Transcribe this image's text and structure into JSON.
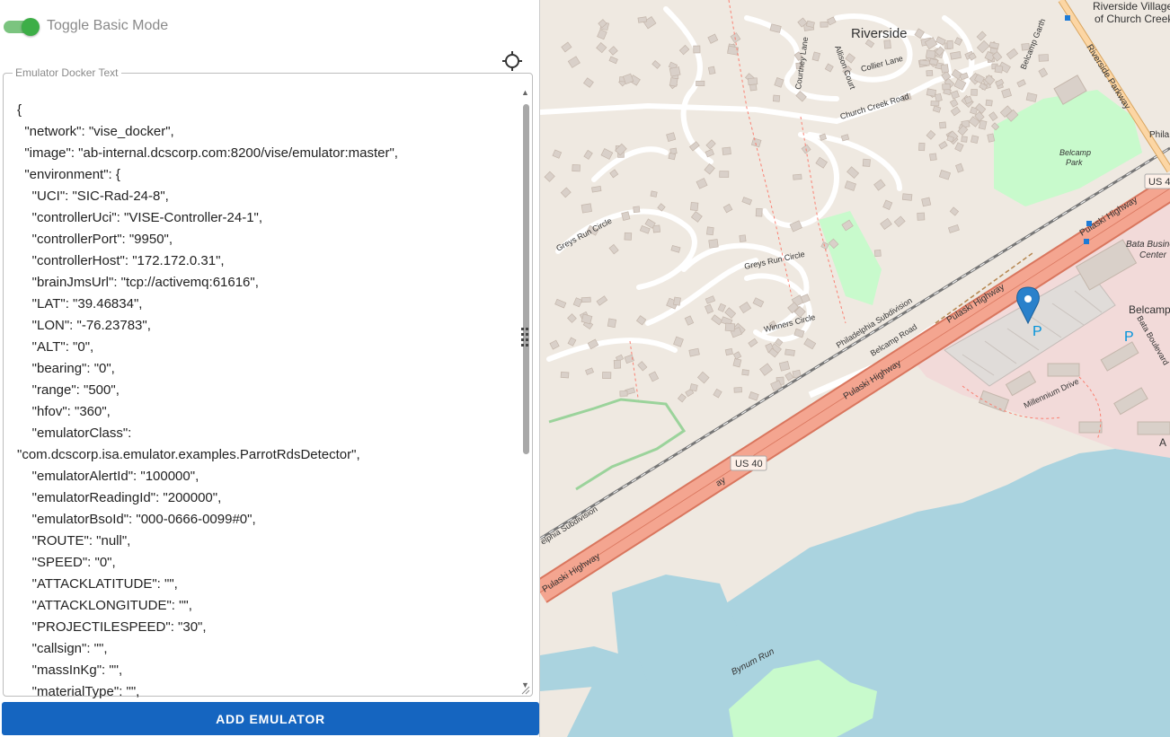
{
  "toggle": {
    "label": "Toggle Basic Mode",
    "on": true
  },
  "emulator_box": {
    "legend": "Emulator Docker Text",
    "lines": [
      "{",
      "  \"network\": \"vise_docker\",",
      "  \"image\": \"ab-internal.dcscorp.com:8200/vise/emulator:master\",",
      "  \"environment\": {",
      "    \"UCI\": \"SIC-Rad-24-8\",",
      "    \"controllerUci\": \"VISE-Controller-24-1\",",
      "    \"controllerPort\": \"9950\",",
      "    \"controllerHost\": \"172.172.0.31\",",
      "    \"brainJmsUrl\": \"tcp://activemq:61616\",",
      "    \"LAT\": \"39.46834\",",
      "    \"LON\": \"-76.23783\",",
      "    \"ALT\": \"0\",",
      "    \"bearing\": \"0\",",
      "    \"range\": \"500\",",
      "    \"hfov\": \"360\",",
      "    \"emulatorClass\":",
      "\"com.dcscorp.isa.emulator.examples.ParrotRdsDetector\",",
      "    \"emulatorAlertId\": \"100000\",",
      "    \"emulatorReadingId\": \"200000\",",
      "    \"emulatorBsoId\": \"000-0666-0099#0\",",
      "    \"ROUTE\": \"null\",",
      "    \"SPEED\": \"0\",",
      "    \"ATTACKLATITUDE\": \"\",",
      "    \"ATTACKLONGITUDE\": \"\",",
      "    \"PROJECTILESPEED\": \"30\",",
      "    \"callsign\": \"\",",
      "    \"massInKg\": \"\",",
      "    \"materialType\": \"\","
    ]
  },
  "add_button": {
    "label": "ADD EMULATOR"
  },
  "map": {
    "labels": {
      "riverside": "Riverside",
      "riverside_village_1": "Riverside Village",
      "riverside_village_2": "of Church Creek",
      "riverside_parkway": "Riverside Parkway",
      "belcamp_garth": "Belcamp Garth",
      "courtney_lane": "Courtney Lane",
      "allison_court": "Allison Court",
      "collier_lane": "Collier Lane",
      "church_creek_road": "Church Creek Road",
      "belcamp_park_1": "Belcamp",
      "belcamp_park_2": "Park",
      "greys_run_circle_1": "Greys Run Circle",
      "greys_run_circle_2": "Greys Run Circle",
      "winners_circle": "Winners Circle",
      "philadelphia_subdivision_1": "Philadelphia Subdivision",
      "philadelphia_subdivision_2": "elphia Subdivision",
      "belcamp_road": "Belcamp Road",
      "pulaski_highway_1": "Pulaski Highway",
      "pulaski_highway_2": "Pulaski Highway",
      "pulaski_highway_3": "Pulaski Highway",
      "pulaski_highway_4": "Pulaski Highway",
      "pulaski_highway_5": "ay",
      "us40_1": "US 40",
      "us40_2": "US 4",
      "bata_1": "Bata Busine",
      "bata_2": "Center",
      "belcamp_right": "Belcamp",
      "bata_boulevard": "Bata Boulevard",
      "millennium_drive": "Millennium Drive",
      "bynum_run": "Bynum Run",
      "parking": "P",
      "phila_edge": "Phila",
      "a_edge": "A"
    },
    "colors": {
      "land": "#efe9e1",
      "water": "#aad3df",
      "park": "#c8facc",
      "highway": "#f29b82",
      "trunk": "#f9b29c",
      "building": "#d9d0c9",
      "commercial": "#f2dad9",
      "marker": "#2a81cb",
      "button": "#1565c0",
      "toggle": "#3dae47"
    }
  }
}
